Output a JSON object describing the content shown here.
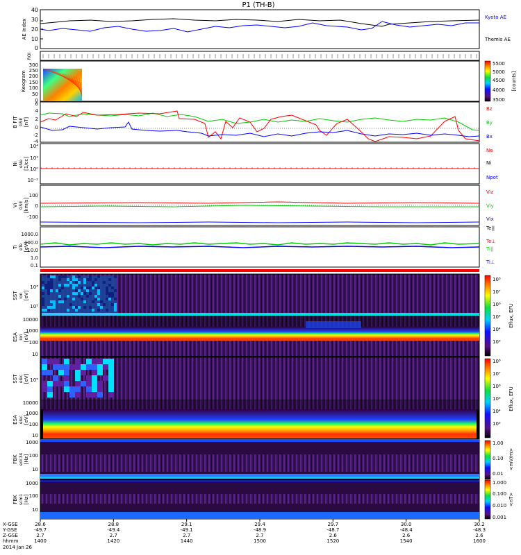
{
  "title": "P1 (TH-B)",
  "colors": {
    "kyoto": "#0000ff",
    "themis": "#000000",
    "bz": "#ff0000",
    "by": "#00cc00",
    "bx": "#0000ff",
    "ne": "#ff0000",
    "ni": "#000000",
    "npot": "#0000ff",
    "te": "#ff0000",
    "ti": "#00cc00",
    "roi_bar": "#ff0000"
  },
  "panels": {
    "ae": {
      "ylabel": "AE Index",
      "yticks": [
        "40",
        "30",
        "20",
        "10",
        "0"
      ],
      "legend": [
        "Kyoto AE",
        "Themis AE"
      ]
    },
    "roi": {
      "ylabel": "ROI"
    },
    "keogram": {
      "ylabel": "Keogram",
      "yticks": [
        "300",
        "250",
        "200",
        "150",
        "100",
        "50",
        "0"
      ],
      "colorbar_label": "[counts]",
      "colorbar_ticks": [
        "5500",
        "5000",
        "4500",
        "4000",
        "3500"
      ]
    },
    "bfield": {
      "ylabel": [
        "B FIT",
        "GSE",
        "[nT]"
      ],
      "yticks": [
        "6",
        "4",
        "2",
        "0",
        "-2",
        "-4"
      ],
      "legend": [
        "Bz",
        "By",
        "Bx"
      ]
    },
    "density": {
      "ylabel": [
        "Ni",
        "eNe",
        "[1/cc]"
      ],
      "yticks": [
        "10⁴",
        "10²",
        "10⁰",
        "10⁻²"
      ],
      "legend": [
        "Ne",
        "Ni",
        "Npot"
      ]
    },
    "velocity": {
      "ylabel": [
        "Vi",
        "GSE",
        "[km/s]"
      ],
      "yticks": [
        "100",
        "0",
        "-100"
      ],
      "legend": [
        "Viz",
        "Viy",
        "Vix"
      ]
    },
    "temp": {
      "ylabel": [
        "Ti",
        "eTe",
        "[eV]"
      ],
      "yticks": [
        "1000.0",
        "100.0",
        "10.0",
        "1.0",
        "0.1"
      ],
      "legend": [
        "Te||",
        "Te⊥",
        "Ti||",
        "Ti⊥"
      ]
    },
    "sst_i": {
      "ylabel": [
        "SST",
        "ion",
        "[eV]"
      ],
      "yticks": [
        "10⁶",
        "10⁵"
      ]
    },
    "esa_i": {
      "ylabel": [
        "ESA",
        "ion",
        "[eV]"
      ],
      "yticks": [
        "10000",
        "1000",
        "100",
        "10"
      ],
      "colorbar_label": "Eflux, EFU",
      "colorbar_ticks": [
        "10⁸",
        "10⁷",
        "10⁶",
        "10⁵",
        "10⁴",
        "10³"
      ]
    },
    "sst_e": {
      "ylabel": [
        "SST",
        "elec",
        "[eV]"
      ],
      "yticks": [
        "10⁵"
      ]
    },
    "esa_e": {
      "ylabel": [
        "ESA",
        "elec",
        "[eV]"
      ],
      "yticks": [
        "10000",
        "1000",
        "100",
        "10"
      ],
      "colorbar_label": "Eflux, EFU",
      "colorbar_ticks": [
        "10⁸",
        "10⁷",
        "10⁶",
        "10⁵",
        "10⁴",
        "10³"
      ]
    },
    "fbk_e": {
      "ylabel": [
        "FBK",
        "edc34",
        "[Hz]"
      ],
      "yticks": [
        "1000",
        "100",
        "10"
      ],
      "colorbar_label": "<mV/m>",
      "colorbar_ticks": [
        "1.00",
        "0.10",
        "0.01"
      ]
    },
    "fbk_b": {
      "ylabel": [
        "FBK",
        "scm1",
        "[Hz]"
      ],
      "yticks": [
        "1000",
        "100",
        "10"
      ],
      "colorbar_label": "<nT>",
      "colorbar_ticks": [
        "1.000",
        "0.100",
        "0.010",
        "0.001"
      ]
    }
  },
  "xaxis": {
    "row_labels": [
      "X-GSE",
      "Y-GSE",
      "Z-GSE",
      "hhmm",
      "2014 Jan 26"
    ],
    "columns": [
      [
        "28.6",
        "-49.7",
        "2.7",
        "1400"
      ],
      [
        "28.8",
        "-49.4",
        "2.7",
        "1420"
      ],
      [
        "29.1",
        "-49.1",
        "2.7",
        "1440"
      ],
      [
        "29.4",
        "-48.9",
        "2.7",
        "1500"
      ],
      [
        "29.7",
        "-48.7",
        "2.6",
        "1520"
      ],
      [
        "30.0",
        "-48.4",
        "2.6",
        "1540"
      ],
      [
        "30.2",
        "-48.3",
        "2.6",
        "1600"
      ]
    ]
  },
  "chart_data": [
    {
      "type": "line",
      "title": "P1 (TH-B)",
      "ylabel": "AE Index",
      "ylim": [
        0,
        40
      ],
      "x": [
        "1400",
        "1420",
        "1440",
        "1500",
        "1520",
        "1540",
        "1600"
      ],
      "series": [
        {
          "name": "Kyoto AE",
          "values": [
            22,
            18,
            20,
            16,
            24,
            20,
            28
          ]
        },
        {
          "name": "Themis AE",
          "values": [
            27,
            28,
            29,
            28,
            30,
            24,
            32
          ]
        }
      ]
    },
    {
      "type": "heatmap",
      "ylabel": "Keogram",
      "ylim": [
        0,
        300
      ],
      "colorbar": "[counts]",
      "crange": [
        3500,
        5500
      ]
    },
    {
      "type": "line",
      "ylabel": "B FIT GSE [nT]",
      "ylim": [
        -4,
        6
      ],
      "x": [
        "1400",
        "1420",
        "1440",
        "1500",
        "1520",
        "1540",
        "1600"
      ],
      "series": [
        {
          "name": "Bz",
          "values": [
            3,
            3.5,
            3,
            -1.5,
            2,
            -2.5,
            -3
          ]
        },
        {
          "name": "By",
          "values": [
            3.5,
            3,
            3,
            1,
            1.5,
            1.5,
            0.5
          ]
        },
        {
          "name": "Bx",
          "values": [
            0,
            1,
            0,
            -1,
            -1,
            -0.5,
            -2
          ]
        }
      ]
    },
    {
      "type": "line",
      "ylabel": "Ni eNe [1/cc]",
      "x": [
        "1400",
        "1600"
      ],
      "series": [
        {
          "name": "Ne",
          "values": [
            1,
            1
          ]
        }
      ]
    },
    {
      "type": "line",
      "ylabel": "Vi GSE [km/s]",
      "ylim": [
        -150,
        150
      ],
      "x": [
        "1400",
        "1600"
      ],
      "series": [
        {
          "name": "Viz",
          "values": [
            15,
            15
          ]
        },
        {
          "name": "Viy",
          "values": [
            0,
            0
          ]
        },
        {
          "name": "Vix",
          "values": [
            -100,
            -100
          ]
        }
      ]
    },
    {
      "type": "line",
      "ylabel": "Ti eTe [eV]",
      "x": [
        "1400",
        "1600"
      ],
      "series": [
        {
          "name": "Ti||",
          "values": [
            25,
            25
          ]
        },
        {
          "name": "Ti⊥",
          "values": [
            18,
            18
          ]
        }
      ]
    }
  ]
}
